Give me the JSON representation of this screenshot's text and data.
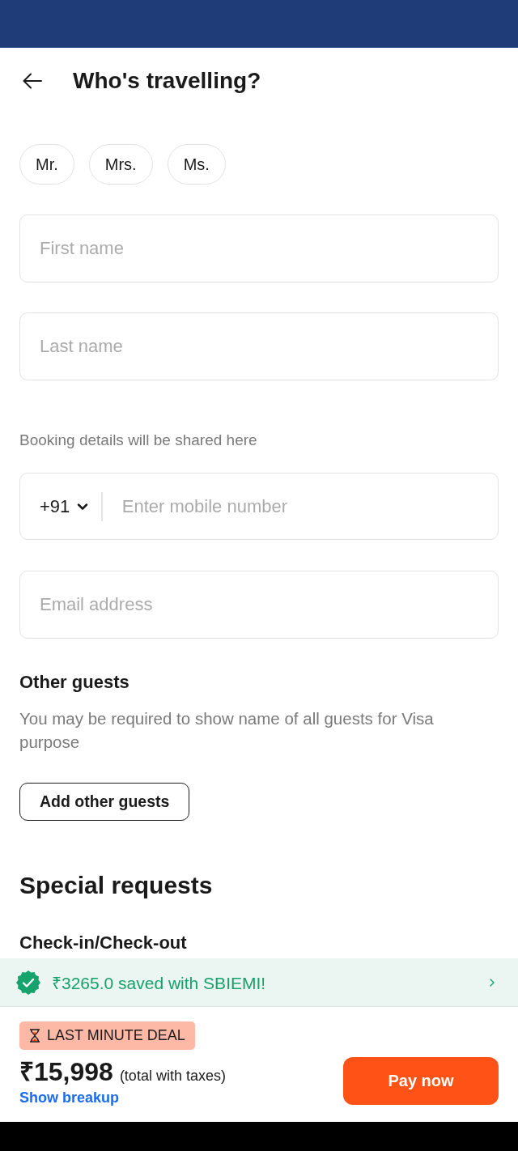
{
  "header": {
    "title": "Who's travelling?"
  },
  "salutations": [
    {
      "label": "Mr.",
      "selected": false
    },
    {
      "label": "Mrs.",
      "selected": false
    },
    {
      "label": "Ms.",
      "selected": false
    }
  ],
  "name_fields": [
    {
      "placeholder": "First name"
    },
    {
      "placeholder": "Last name"
    }
  ],
  "contact": {
    "note": "Booking details will be shared here",
    "country_code": "+91",
    "phone_placeholder": "Enter mobile number",
    "email_placeholder": "Email address"
  },
  "other_guests": {
    "title": "Other guests",
    "description": "You may be required to show name of all guests for Visa purpose",
    "button": "Add other guests"
  },
  "special_requests": {
    "title": "Special requests",
    "subtitle": "Check-in/Check-out"
  },
  "savings_banner": {
    "text": "₹3265.0 saved with SBIEMI!"
  },
  "footer": {
    "badge": "LAST MINUTE DEAL",
    "price": "₹15,998",
    "price_note": "(total with taxes)",
    "link": "Show breakup",
    "button": "Pay now"
  }
}
